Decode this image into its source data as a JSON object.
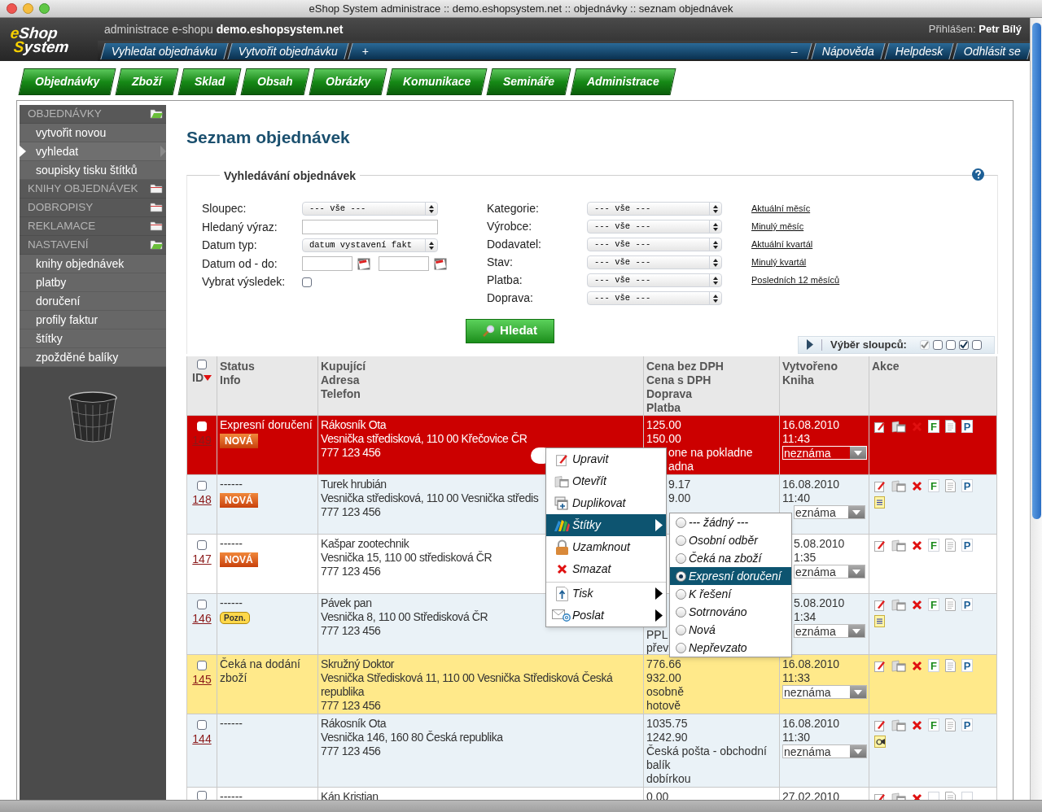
{
  "window": {
    "title": "eShop System administrace :: demo.eshopsystem.net :: objednávky :: seznam objednávek"
  },
  "header": {
    "logo": [
      "eShop",
      "System"
    ],
    "caption": "administrace e-shopu",
    "domain": "demo.eshopsystem.net",
    "login_label": "Přihlášen:",
    "user": "Petr Bílý"
  },
  "toolbar": {
    "left": [
      "Vyhledat objednávku",
      "Vytvořit objednávku"
    ],
    "expand": "+",
    "collapse": "–",
    "right": [
      "Nápověda",
      "Helpdesk",
      "Odhlásit se"
    ]
  },
  "main_tabs": [
    "Objednávky",
    "Zboží",
    "Sklad",
    "Obsah",
    "Obrázky",
    "Komunikace",
    "Semináře",
    "Administrace"
  ],
  "sidebar": [
    {
      "label": "OBJEDNÁVKY",
      "expanded": true,
      "children": [
        {
          "label": "vytvořit novou",
          "selected": false
        },
        {
          "label": "vyhledat",
          "selected": true
        },
        {
          "label": "soupisky tisku štítků",
          "selected": false
        }
      ]
    },
    {
      "label": "KNIHY OBJEDNÁVEK",
      "expanded": false
    },
    {
      "label": "DOBROPISY",
      "expanded": false
    },
    {
      "label": "REKLAMACE",
      "expanded": false
    },
    {
      "label": "NASTAVENÍ",
      "expanded": true,
      "children": [
        {
          "label": "knihy objednávek",
          "selected": false
        },
        {
          "label": "platby",
          "selected": false
        },
        {
          "label": "doručení",
          "selected": false
        },
        {
          "label": "profily faktur",
          "selected": false
        },
        {
          "label": "štítky",
          "selected": false
        },
        {
          "label": "zpožděné balíky",
          "selected": false
        }
      ]
    }
  ],
  "page_title": "Seznam objednávek",
  "search": {
    "legend": "Vyhledávání objednávek",
    "left_fields": [
      {
        "label": "Sloupec:",
        "kind": "select",
        "value": "--- vše ---"
      },
      {
        "label": "Hledaný výraz:",
        "kind": "text"
      },
      {
        "label": "Datum typ:",
        "kind": "select",
        "value": "datum vystavení fakt"
      },
      {
        "label": "Datum od - do:",
        "kind": "date_range"
      },
      {
        "label": "Vybrat výsledek:",
        "kind": "checkbox",
        "checked": false
      }
    ],
    "right_fields": [
      {
        "label": "Kategorie:",
        "value": "--- vše ---"
      },
      {
        "label": "Výrobce:",
        "value": "--- vše ---"
      },
      {
        "label": "Dodavatel:",
        "value": "--- vše ---"
      },
      {
        "label": "Stav:",
        "value": "--- vše ---"
      },
      {
        "label": "Platba:",
        "value": "--- vše ---"
      },
      {
        "label": "Doprava:",
        "value": "--- vše ---"
      }
    ],
    "quick_links": [
      "Aktuální měsíc",
      "Minulý měsíc",
      "Aktuální kvartál",
      "Minulý kvartál",
      "Posledních 12 měsíců"
    ],
    "button": "Hledat"
  },
  "column_picker": {
    "label": "Výběr sloupců:",
    "options": [
      {
        "checked": true,
        "disabled": true
      },
      {
        "checked": false,
        "disabled": false
      },
      {
        "checked": false,
        "disabled": false
      },
      {
        "checked": true,
        "disabled": false
      },
      {
        "checked": false,
        "disabled": false
      }
    ]
  },
  "table": {
    "select_all": {
      "checked": false
    },
    "columns": [
      {
        "lines": [
          "ID"
        ],
        "sort_descending": true
      },
      {
        "lines": [
          "Status",
          "Info"
        ]
      },
      {
        "lines": [
          "Kupující",
          "Adresa",
          "Telefon"
        ]
      },
      {
        "lines": [
          "Cena bez DPH",
          "Cena s DPH",
          "Doprava",
          "Platba"
        ]
      },
      {
        "lines": [
          "Vytvořeno",
          "Kniha"
        ]
      },
      {
        "lines": [
          "Akce"
        ]
      }
    ],
    "actions": [
      {
        "kind": "edit"
      },
      {
        "kind": "open"
      },
      {
        "kind": "delete"
      },
      {
        "kind": "letter",
        "color": "#1a8a1a"
      },
      {
        "kind": "doc"
      },
      {
        "kind": "letter",
        "color": "#1d5f96"
      }
    ],
    "rows": [
      {
        "checked": false,
        "id": "149",
        "color": "#cc0000",
        "status": [
          "Expresní doručení"
        ],
        "badge": {
          "kind": "new",
          "label": "NOVÁ"
        },
        "customer": [
          "Rákosník Ota",
          "Vesnička středisková, 110 00 Křečovice ČR",
          "777 123 456"
        ],
        "price": [
          "125.00",
          "150.00",
          "one na pokladne",
          "adna"
        ],
        "created": [
          "16.08.2010",
          "11:43"
        ],
        "book": "neznáma",
        "action_labels": [
          "F",
          "P"
        ]
      },
      {
        "checked": false,
        "id": "148",
        "color": "#eaf2f7",
        "status": [
          "------"
        ],
        "badge": {
          "kind": "new",
          "label": "NOVÁ"
        },
        "customer": [
          "Turek hrubián",
          "Vesnička středisková, 110 00 Vesnička středis",
          "777 123 456"
        ],
        "price": [
          "9.17",
          "9.00"
        ],
        "created": [
          "16.08.2010",
          "11:40"
        ],
        "book": "eznáma",
        "action_labels": [
          "F",
          "P"
        ],
        "attachment": {
          "kind": "note"
        }
      },
      {
        "checked": false,
        "id": "147",
        "color": "#ffffff",
        "status": [
          "------"
        ],
        "badge": {
          "kind": "new",
          "label": "NOVÁ"
        },
        "customer": [
          "Kašpar zootechnik",
          "Vesnička 15, 110 00 středisková ČR",
          "777 123 456"
        ],
        "price": [],
        "created": [
          "5.08.2010",
          "1:35"
        ],
        "book": "eznáma",
        "action_labels": [
          "F",
          "P"
        ]
      },
      {
        "checked": false,
        "id": "146",
        "color": "#eaf2f7",
        "status": [
          "------"
        ],
        "badge": {
          "kind": "note",
          "label": "Pozn."
        },
        "customer": [
          "Pávek pan",
          "Vesnička 8, 110 00 Středisková ČR",
          "777 123 456"
        ],
        "price": [
          "PPL",
          "přev"
        ],
        "created": [
          "5.08.2010",
          "1:34"
        ],
        "book": "eznáma",
        "action_labels": [
          "F",
          "P"
        ],
        "attachment": {
          "kind": "note"
        }
      },
      {
        "checked": false,
        "id": "145",
        "color": "#ffe98a",
        "status": [
          "Čeká na dodání zboží"
        ],
        "customer": [
          "Skružný Doktor",
          "Vesnička Středisková 11, 110 00 Vesnička Středisková Česká republika",
          "777 123 456"
        ],
        "price": [
          "776.66",
          "932.00",
          "osobně",
          "hotově"
        ],
        "created": [
          "16.08.2010",
          "11:33"
        ],
        "book": "neznáma",
        "action_labels": [
          "F",
          "P"
        ]
      },
      {
        "checked": false,
        "id": "144",
        "color": "#eaf2f7",
        "status": [
          "------"
        ],
        "customer": [
          "Rákosník Ota",
          "Vesnička 146, 160 80 Česká republika",
          "777 123 456"
        ],
        "price": [
          "1035.75",
          "1242.90",
          "Česká pošta - obchodní balík",
          "dobírkou"
        ],
        "created": [
          "16.08.2010",
          "11:30"
        ],
        "book": "neznáma",
        "action_labels": [
          "F",
          "P"
        ],
        "attachment": {
          "kind": "post"
        }
      },
      {
        "checked": false,
        "color": "#ffffff",
        "status": [
          "------"
        ],
        "customer": [
          "Kán Kristian"
        ],
        "price": [
          "0.00"
        ],
        "created": [
          "27.02.2010"
        ]
      }
    ]
  },
  "context_menu": {
    "groups": [
      [
        {
          "label": "Upravit",
          "submenu": false,
          "selected": false
        },
        {
          "label": "Otevřít",
          "submenu": false,
          "selected": false
        },
        {
          "label": "Duplikovat",
          "submenu": false,
          "selected": false
        },
        {
          "label": "Štítky",
          "submenu": true,
          "selected": true
        },
        {
          "label": "Uzamknout",
          "submenu": false,
          "selected": false
        },
        {
          "label": "Smazat",
          "submenu": false,
          "selected": false
        }
      ],
      [
        {
          "label": "Tisk",
          "submenu": true,
          "selected": false
        },
        {
          "label": "Poslat",
          "submenu": true,
          "selected": false
        }
      ]
    ],
    "submenu": [
      {
        "label": "--- žádný ---",
        "selected": false
      },
      {
        "label": "Osobní odběr",
        "selected": false
      },
      {
        "label": "Čeká na zboží",
        "selected": false
      },
      {
        "label": "Expresní doručení",
        "selected": true
      },
      {
        "label": "K řešení",
        "selected": false
      },
      {
        "label": "Sotrnováno",
        "selected": false
      },
      {
        "label": "Nová",
        "selected": false
      },
      {
        "label": "Nepřevzato",
        "selected": false
      }
    ]
  }
}
